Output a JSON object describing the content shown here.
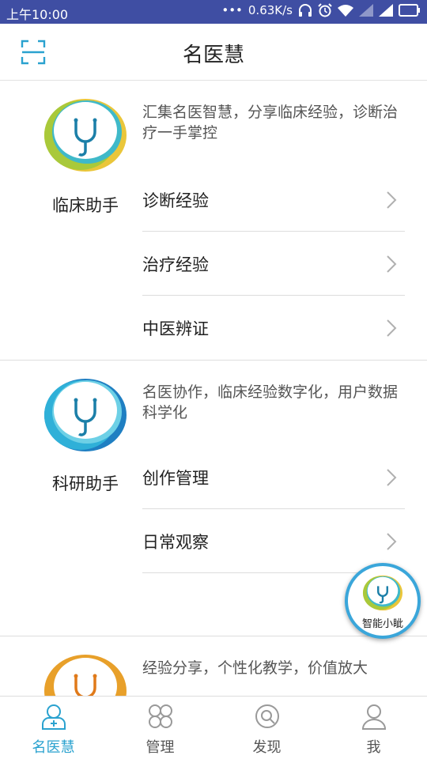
{
  "status_bar": {
    "time": "上午10:00",
    "net_speed": "0.63K/s"
  },
  "header": {
    "title": "名医慧"
  },
  "sections": [
    {
      "name": "临床助手",
      "description": "汇集名医智慧，分享临床经验，诊断治疗一手掌控",
      "items": [
        "诊断经验",
        "治疗经验",
        "中医辨证"
      ]
    },
    {
      "name": "科研助手",
      "description": "名医协作，临床经验数字化，用户数据科学化",
      "items": [
        "创作管理",
        "日常观察"
      ]
    },
    {
      "name": "",
      "description": "经验分享，个性化教学，价值放大",
      "items": []
    }
  ],
  "fab": {
    "label": "智能小眦"
  },
  "nav": {
    "tabs": [
      {
        "label": "名医慧",
        "icon": "doctor-icon",
        "active": true
      },
      {
        "label": "管理",
        "icon": "grid-icon",
        "active": false
      },
      {
        "label": "发现",
        "icon": "discover-search-icon",
        "active": false
      },
      {
        "label": "我",
        "icon": "user-icon",
        "active": false
      }
    ]
  },
  "colors": {
    "status_bar": "#3f4ea3",
    "accent": "#2aa2cf"
  }
}
